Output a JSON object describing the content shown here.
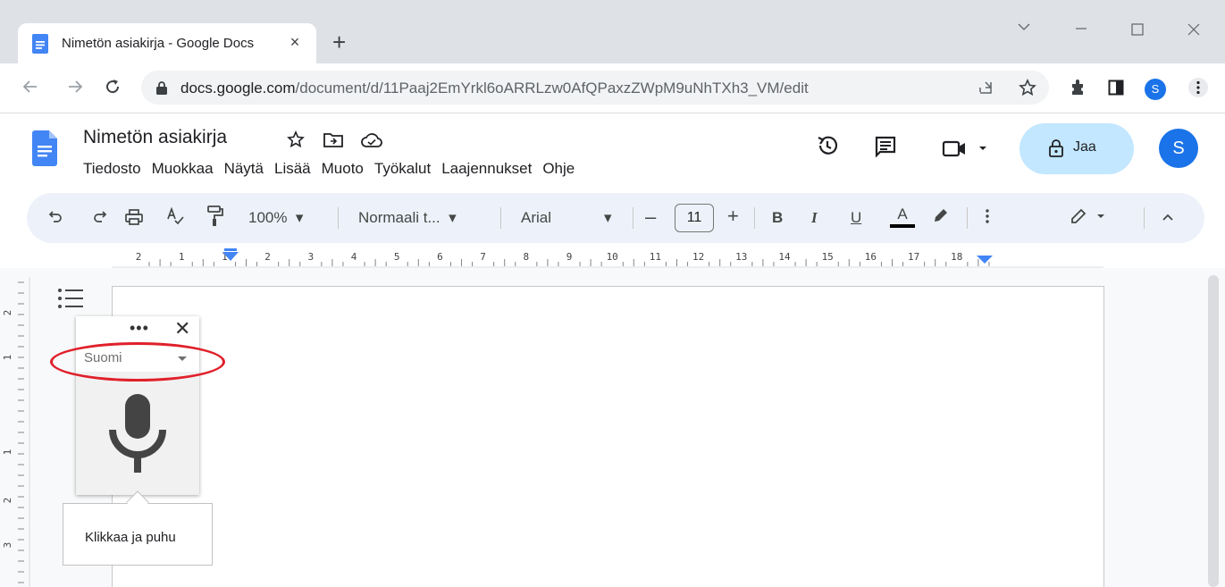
{
  "browser": {
    "tab_title": "Nimetön asiakirja - Google Docs",
    "tab_close": "×",
    "new_tab": "+",
    "url_host": "docs.google.com",
    "url_path": "/document/d/11Paaj2EmYrkl6oARRLzw0AfQPaxzZWpM9uNhTXh3_VM/edit",
    "profile_initial": "S"
  },
  "docs": {
    "title": "Nimetön asiakirja",
    "menu": [
      "Tiedosto",
      "Muokkaa",
      "Näytä",
      "Lisää",
      "Muoto",
      "Työkalut",
      "Laajennukset",
      "Ohje"
    ],
    "share_label": "Jaa",
    "avatar_initial": "S"
  },
  "toolbar": {
    "zoom": "100%",
    "style": "Normaali t...",
    "font": "Arial",
    "font_size": "11",
    "bold": "B",
    "italic": "I",
    "underline": "U",
    "text_color": "A"
  },
  "ruler": {
    "labels": [
      "2",
      "1",
      "1",
      "2",
      "3",
      "4",
      "5",
      "6",
      "7",
      "8",
      "9",
      "10",
      "11",
      "12",
      "13",
      "14",
      "15",
      "16",
      "17",
      "18"
    ],
    "vertical_labels": [
      "2",
      "1",
      "1",
      "2",
      "3"
    ]
  },
  "voice_typing": {
    "more": "•••",
    "close": "✕",
    "language": "Suomi",
    "tooltip": "Klikkaa ja puhu"
  },
  "colors": {
    "accent": "#1a73e8",
    "share_bg": "#c2e7ff",
    "highlight_oval": "#e0202a"
  }
}
